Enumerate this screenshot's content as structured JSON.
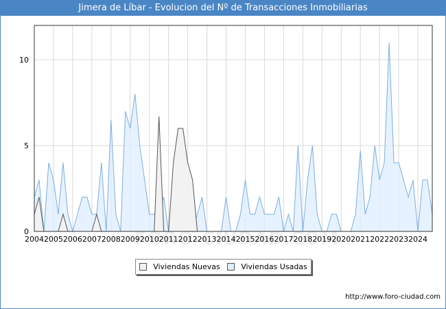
{
  "chart_data": {
    "type": "area",
    "title": "Jimera de Líbar - Evolucion del Nº de Transacciones Inmobiliarias",
    "xlabel": "",
    "ylabel": "",
    "xlim": [
      2004,
      2024.75
    ],
    "ylim": [
      0,
      12
    ],
    "yticks": [
      0,
      5,
      10
    ],
    "xticks": [
      2004,
      2005,
      2006,
      2007,
      2008,
      2009,
      2010,
      2011,
      2012,
      2013,
      2014,
      2015,
      2016,
      2017,
      2018,
      2019,
      2020,
      2021,
      2022,
      2023,
      2024
    ],
    "grid": true,
    "legend_position": "bottom-center",
    "x_step": 0.25,
    "x_start": 2004,
    "series": [
      {
        "name": "Viviendas Nuevas",
        "color": "#f2f2f2",
        "stroke": "#555555",
        "values": [
          1,
          2,
          0,
          0,
          0,
          0,
          1,
          0,
          0,
          0,
          0,
          0,
          0,
          1,
          0,
          0,
          0,
          0,
          0,
          0,
          0,
          0,
          0,
          0,
          0,
          0,
          6.7,
          0,
          0,
          4,
          6,
          6,
          4,
          3,
          0,
          0,
          0,
          0,
          0,
          0,
          0,
          0,
          0,
          0,
          0,
          0,
          0,
          0,
          0,
          0,
          0,
          0,
          0,
          0,
          0,
          0,
          0,
          0,
          0,
          0,
          0,
          0,
          0,
          0,
          0,
          0,
          0,
          0,
          0,
          0,
          0,
          0,
          0,
          0,
          0,
          0,
          0,
          0,
          0,
          0,
          0,
          0,
          0,
          0
        ]
      },
      {
        "name": "Viviendas Usadas",
        "color": "#ddeeff",
        "stroke": "#7aaee0",
        "values": [
          2,
          3,
          0,
          4,
          3,
          1,
          4,
          1,
          0,
          1,
          2,
          2,
          1,
          1,
          4,
          0,
          6.5,
          1,
          0,
          7,
          6,
          8,
          5,
          3,
          1,
          1,
          1,
          2,
          0,
          0,
          3,
          0,
          1,
          0,
          1,
          2,
          0,
          0,
          0,
          0,
          2,
          0,
          0,
          1,
          3,
          1,
          1,
          2,
          1,
          1,
          1,
          2,
          0,
          1,
          0,
          5,
          0,
          3,
          5,
          1,
          0,
          0,
          1,
          1,
          0,
          0,
          0,
          1,
          4.7,
          1,
          2,
          5,
          3,
          4,
          11,
          4,
          4,
          3,
          2,
          3,
          0,
          3,
          3,
          1
        ]
      }
    ]
  },
  "footer": {
    "url": "http://www.foro-ciudad.com",
    "watermark": "FORO-CIUDAD.COM"
  }
}
